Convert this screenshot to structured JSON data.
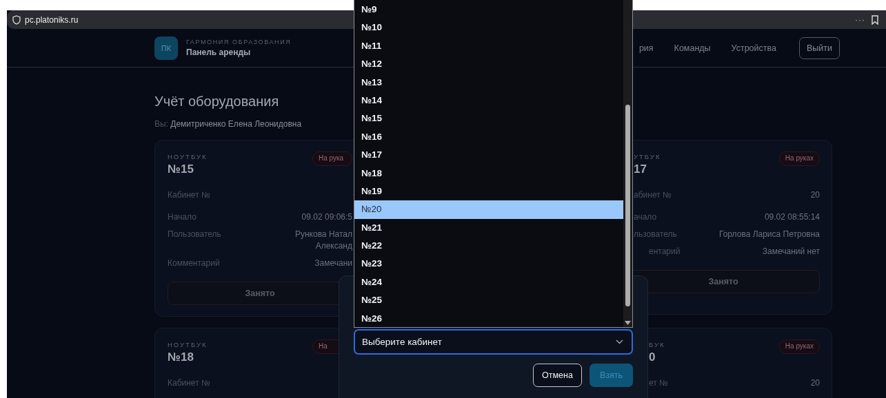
{
  "browser": {
    "url": "pc.platoniks.ru",
    "menu": "···"
  },
  "header": {
    "logo": "ПК",
    "brand": "ГАРМОНИЯ ОБРАЗОВАНИЯ",
    "title": "Панель аренды",
    "nav": [
      "рия",
      "Команды",
      "Устройства"
    ],
    "logout": "Выйти"
  },
  "page": {
    "title": "Учёт оборудования",
    "user_label": "Вы:",
    "user": "Демитриченко Елена Леонидовна"
  },
  "cards": [
    {
      "type": "НОУТБУК",
      "number": "№15",
      "badge": "На рука",
      "rows": [
        {
          "label": "Кабинет №",
          "value_lines": []
        },
        {
          "label": "Начало",
          "value_lines": [
            "09.02 09:06:5"
          ]
        },
        {
          "label": "Пользователь",
          "value_lines": [
            "Рункова Натал",
            "Александ"
          ]
        },
        {
          "label": "Комментарий",
          "value_lines": [
            "Замечани"
          ]
        }
      ],
      "button": "Занято"
    },
    {
      "type": "УТБУК",
      "number": "17",
      "badge": "На руках",
      "rows": [
        {
          "label": "абинет №",
          "value_lines": [
            "20"
          ]
        },
        {
          "label": "ачало",
          "value_lines": [
            "09.02 08:55:14"
          ]
        },
        {
          "label": "льзователь",
          "value_lines": [
            "Горлова Лариса Петровна"
          ]
        },
        {
          "label": "ентарий",
          "value_lines": [
            "Замечаний нет"
          ]
        }
      ],
      "button": "Занято"
    },
    {
      "type": "НОУТБУК",
      "number": "№18",
      "badge": "На",
      "rows": [
        {
          "label": "Кабинет №",
          "value_lines": []
        }
      ]
    },
    {
      "type": "БУК",
      "number": "0",
      "badge": "На руках",
      "rows": [
        {
          "label": "ет №",
          "value_lines": [
            "20"
          ]
        }
      ]
    }
  ],
  "dialog": {
    "select": {
      "placeholder": "Выберите кабинет"
    },
    "cancel": "Отмена",
    "confirm": "Взять"
  },
  "options": [
    {
      "label": "№9",
      "selected": false
    },
    {
      "label": "№10",
      "selected": false
    },
    {
      "label": "№11",
      "selected": false
    },
    {
      "label": "№12",
      "selected": false
    },
    {
      "label": "№13",
      "selected": false
    },
    {
      "label": "№14",
      "selected": false
    },
    {
      "label": "№15",
      "selected": false
    },
    {
      "label": "№16",
      "selected": false
    },
    {
      "label": "№17",
      "selected": false
    },
    {
      "label": "№18",
      "selected": false
    },
    {
      "label": "№19",
      "selected": false
    },
    {
      "label": "№20",
      "selected": true
    },
    {
      "label": "№21",
      "selected": false
    },
    {
      "label": "№22",
      "selected": false
    },
    {
      "label": "№23",
      "selected": false
    },
    {
      "label": "№24",
      "selected": false
    },
    {
      "label": "№25",
      "selected": false
    },
    {
      "label": "№26",
      "selected": false
    }
  ]
}
